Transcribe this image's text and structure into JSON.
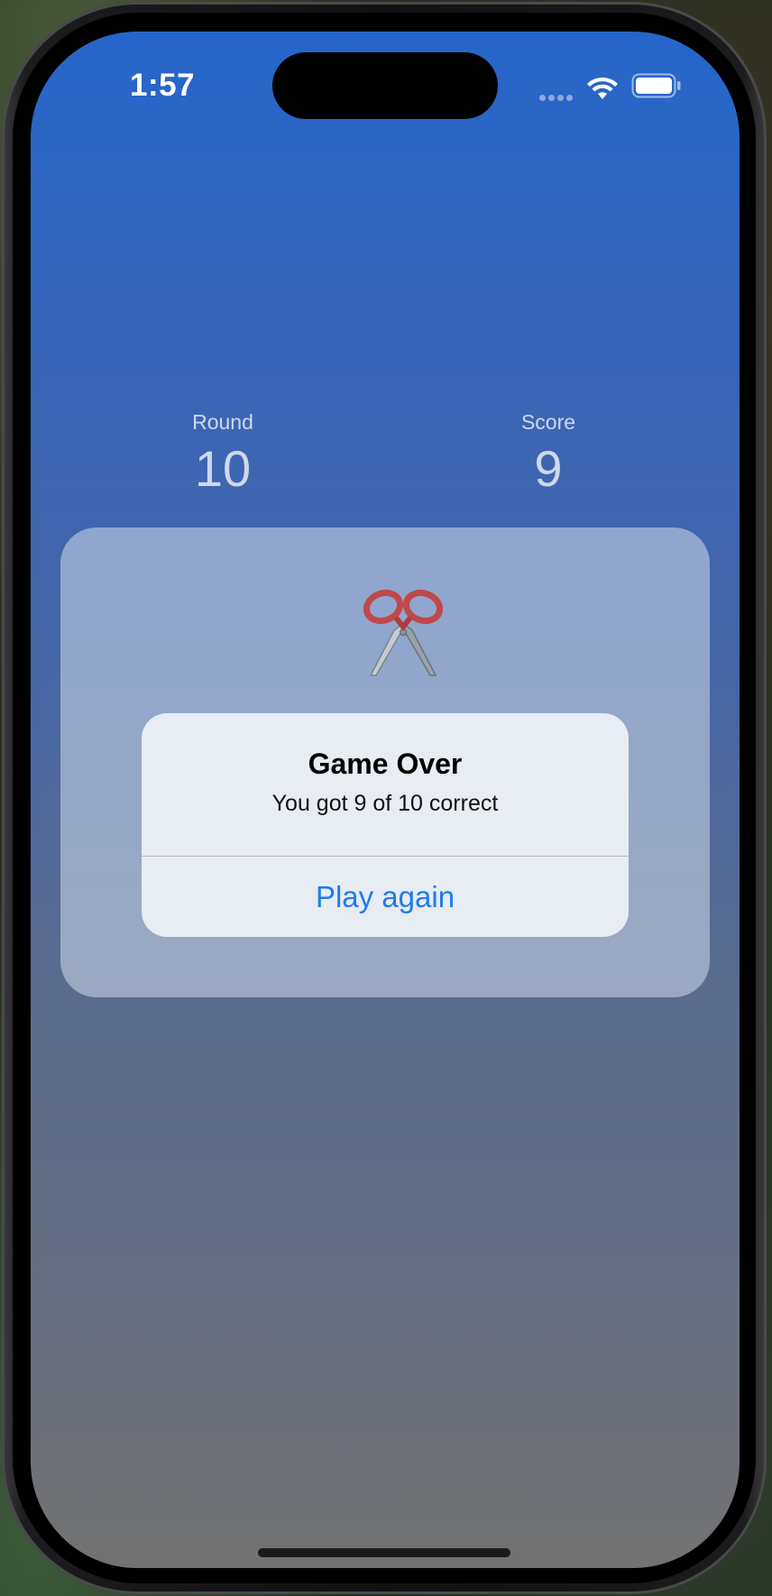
{
  "status_bar": {
    "time": "1:57",
    "wifi_icon": "wifi-icon",
    "battery_icon": "battery-icon",
    "signal_icon": "cellular-signal-icon"
  },
  "stats": {
    "round_label": "Round",
    "round_value": "10",
    "score_label": "Score",
    "score_value": "9"
  },
  "card": {
    "icon": "scissors-icon",
    "icon_glyph": "✂️"
  },
  "alert": {
    "title": "Game Over",
    "message": "You got 9 of 10 correct",
    "button_label": "Play again"
  },
  "colors": {
    "accent": "#1e7bf0",
    "gradient_top": "#2566cb",
    "gradient_bottom": "#727272"
  }
}
